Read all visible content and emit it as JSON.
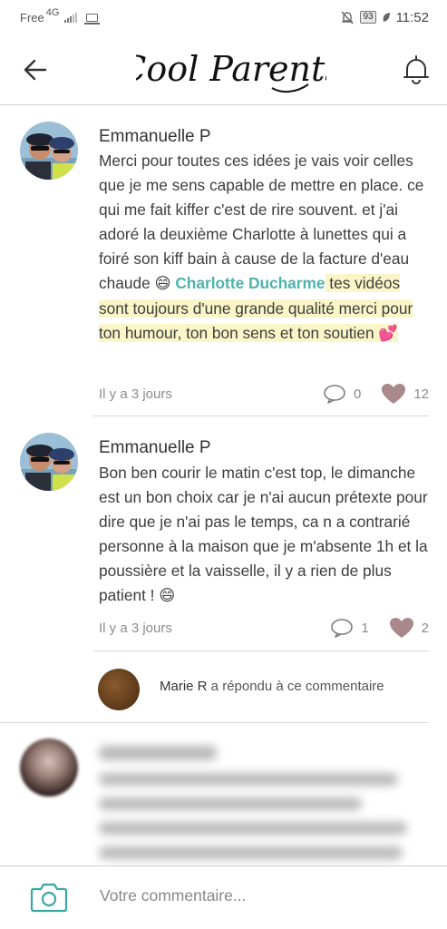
{
  "status_bar": {
    "carrier": "Free",
    "network": "4G",
    "battery": "93",
    "time": "11:52"
  },
  "header": {
    "logo_text": "Cool Parents",
    "back_icon": "arrow-left-icon",
    "notification_icon": "bell-icon"
  },
  "comments": [
    {
      "author": "Emmanuelle P",
      "body_part1": "Merci pour toutes ces idées je vais voir celles que je me sens capable de mettre en place. ce qui me fait kiffer c'est de rire souvent. et j'ai adoré la deuxième Charlotte à lunettes qui a foiré son kiff bain à cause de la facture d'eau chaude ",
      "emoji1": "😄",
      "mention": "Charlotte Ducharme",
      "body_part2": " tes vidéos sont toujours d'une grande qualité merci pour ton humour, ton bon sens et ton soutien ",
      "emoji2": "💕",
      "time": "Il y a 3 jours",
      "replies": "0",
      "likes": "12"
    },
    {
      "author": "Emmanuelle P",
      "body": "Bon ben courir le matin c'est top, le dimanche est un bon choix car je n'ai aucun prétexte pour dire que je n'ai pas le temps, ca n a contrarié personne à la maison que je m'absente 1h et la poussière et la vaisselle, il y a rien de plus patient ! ",
      "emoji": "😄",
      "time": "Il y a 3 jours",
      "replies": "1",
      "likes": "2",
      "reply_preview": {
        "name": "Marie R",
        "text": " a répondu à ce commentaire"
      }
    }
  ],
  "composer": {
    "placeholder": "Votre commentaire...",
    "icon": "camera-icon"
  },
  "colors": {
    "mention": "#4cb3ab",
    "highlight": "#fbf6c7",
    "heart": "#a8888b",
    "camera": "#3aa7a2"
  }
}
